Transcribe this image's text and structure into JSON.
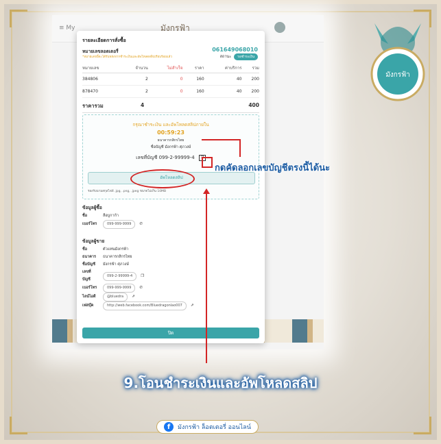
{
  "app": {
    "brand": "มังกรฟ้า",
    "menu_label": "≡ My"
  },
  "modal": {
    "title": "รายละเอียดการสั่งซื้อ",
    "number_label": "หมายเลขลอตเตอรี่",
    "note": "*หมายเลขนี้จะได้รับหลังจากชำระเงินและอัพโหลดสลิปเรียบร้อยแล้ว",
    "order_no": "061649068010",
    "status_label": "สถานะ",
    "status_badge": "รอชำระเงิน",
    "columns": [
      "หมายเลข",
      "จำนวน",
      "ไม่สำเร็จ",
      "ราคา",
      "ค่าบริการ",
      "รวม"
    ],
    "rows": [
      [
        "384806",
        "2",
        "0",
        "160",
        "40",
        "200"
      ],
      [
        "878470",
        "2",
        "0",
        "160",
        "40",
        "200"
      ]
    ],
    "total_label": "ราคารวม",
    "total_qty": "4",
    "total_amount": "400"
  },
  "payment": {
    "heading": "กรุณาชำระเงิน และอัพโหลดสลิปภายใน",
    "timer": "00:59:23",
    "bank": "ธนาคารกสิกรไทย",
    "account_name_label": "ชื่อบัญชี",
    "account_name": "มังกรฟ้า ศุภวงษ์",
    "account_no_label": "เลขที่บัญชี",
    "account_no": "099-2-99999-4",
    "upload_label": "อัพโหลดสลิป",
    "supported": "รองรับนามสกุลไฟล์ .jpg, .png, .jpeg ขนาดไม่เกิน 10MB"
  },
  "buyer": {
    "heading": "ข้อมูลผู้ซื้อ",
    "name_label": "ชื่อ",
    "name": "ลือบูกาก้า",
    "phone_label": "เบอร์โทร",
    "phone": "099-999-9999"
  },
  "seller": {
    "heading": "ข้อมูลผู้ขาย",
    "name_label": "ชื่อ",
    "name": "ตัวแทนมังกรฟ้า",
    "bank_label": "ธนาคาร",
    "bank": "ธนาคารกสิกรไทย",
    "acct_label": "ชื่อบัญชี",
    "acct": "มังกรฟ้า ศุภวงษ์",
    "acno_label": "เลขที่บัญชี",
    "acno": "099-2-99999-4",
    "phone_label": "เบอร์โทร",
    "phone": "099-999-9999",
    "line_label": "ไลน์ไอดี",
    "line": "@bluedra",
    "fb_label": "เฟสบุ๊ค",
    "fb": "http://web.facebook.com/Bluedragonlao007"
  },
  "close_label": "ปิด",
  "annotations": {
    "copy_hint": "กดคัดลอกเลขบัญชีตรงนี้ได้นะ",
    "caption": "9.โอนชำระเงินและอัพโหลดสลิป",
    "footer": "มังกรฟ้า ล็อตเตอรี่ ออนไลน์"
  },
  "colors": {
    "accent": "#3aa5a8",
    "warning": "#e2a21f",
    "annotation": "#d32525",
    "caption_blue": "#1c5ca3"
  }
}
